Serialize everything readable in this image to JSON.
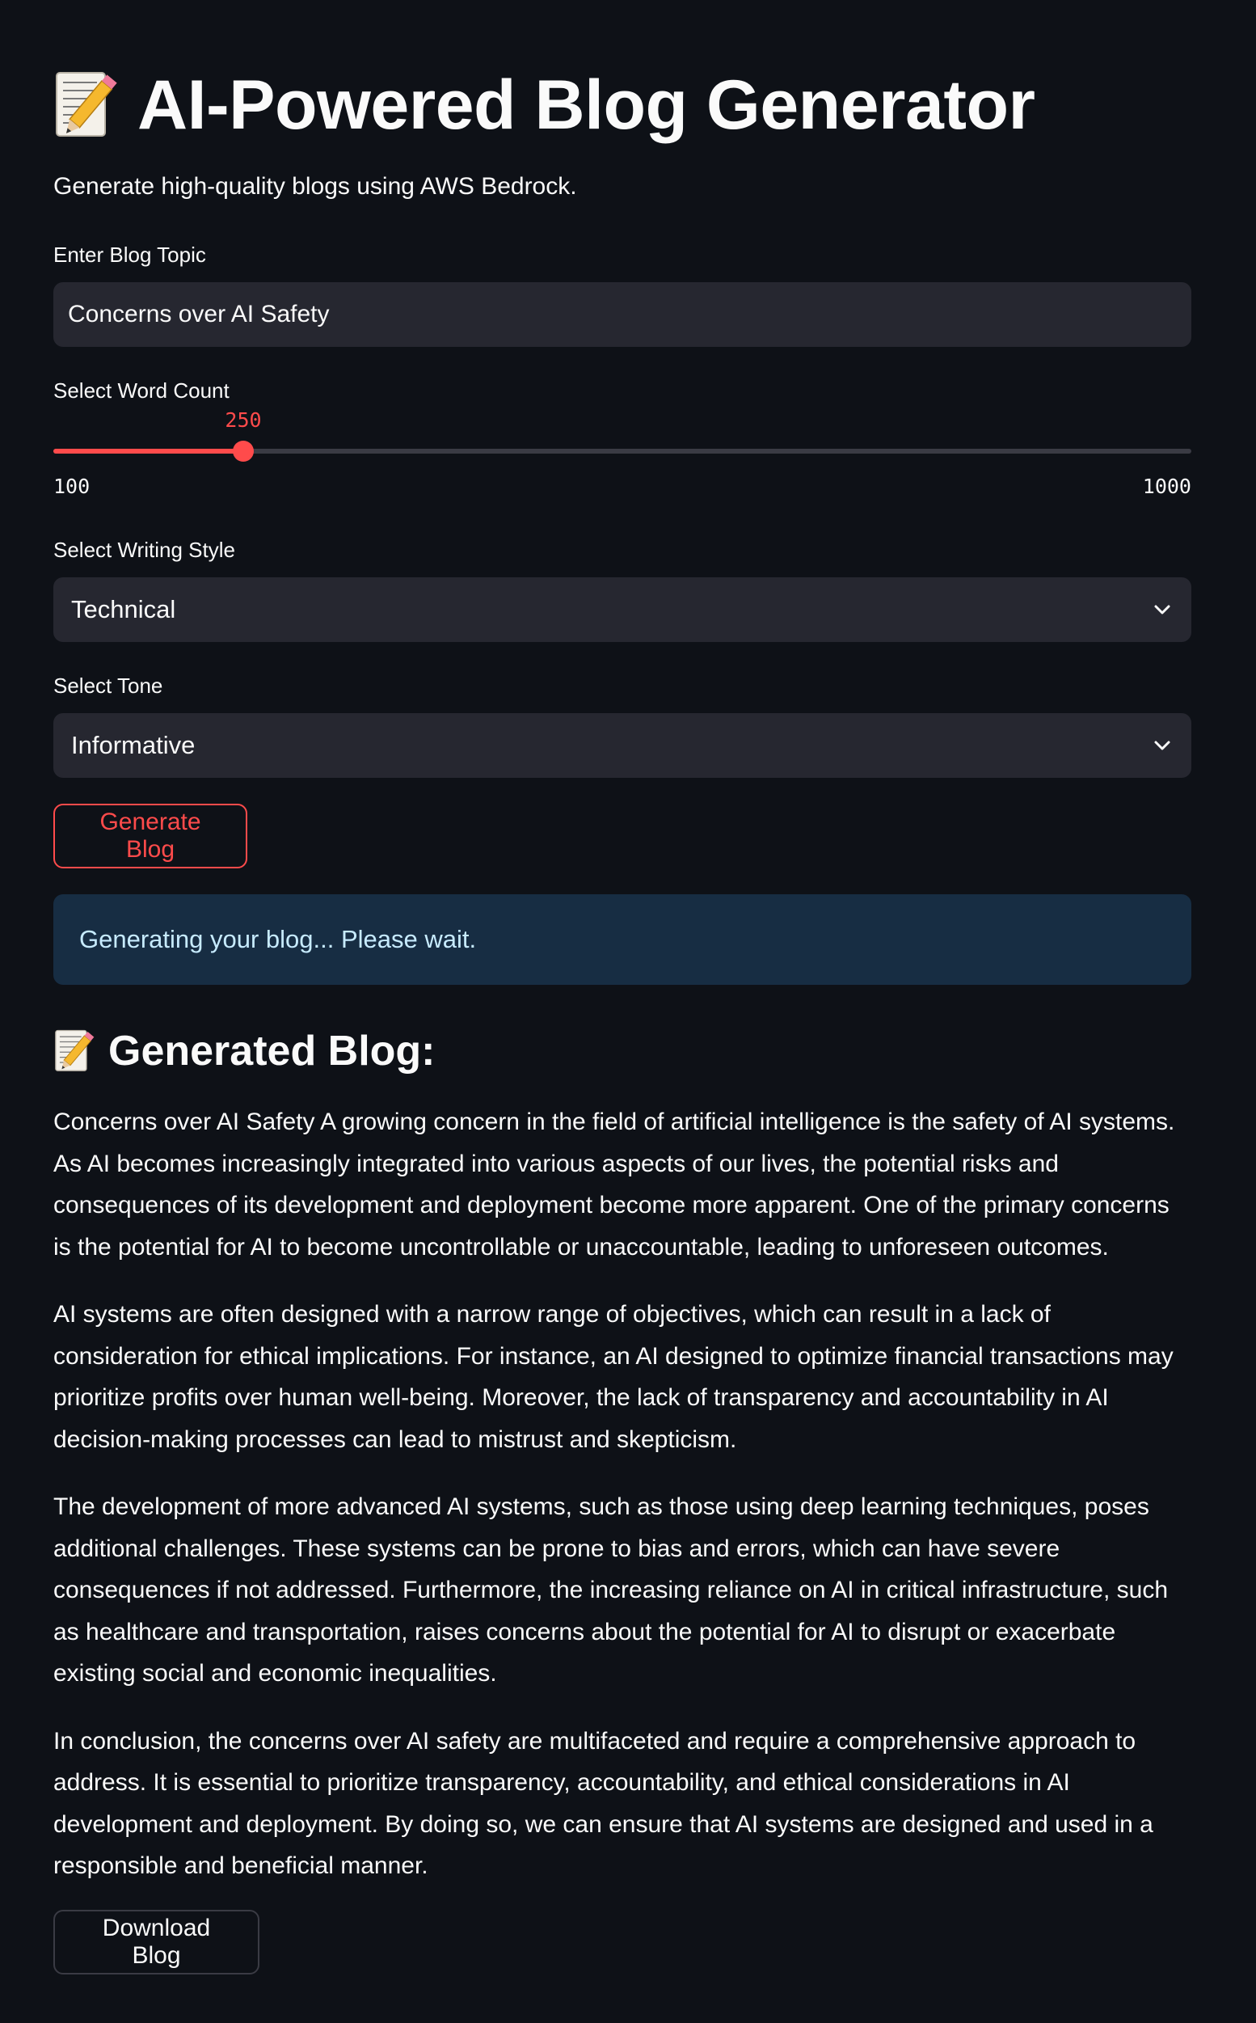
{
  "header": {
    "title": "AI-Powered Blog Generator",
    "subtitle": "Generate high-quality blogs using AWS Bedrock.",
    "title_icon": "memo-icon"
  },
  "form": {
    "topic": {
      "label": "Enter Blog Topic",
      "value": "Concerns over AI Safety"
    },
    "word_count": {
      "label": "Select Word Count",
      "value": 250,
      "value_text": "250",
      "min": 100,
      "min_text": "100",
      "max": 1000,
      "max_text": "1000"
    },
    "style": {
      "label": "Select Writing Style",
      "selected": "Technical"
    },
    "tone": {
      "label": "Select Tone",
      "selected": "Informative"
    },
    "generate_label": "Generate Blog"
  },
  "status": {
    "info_text": "Generating your blog... Please wait."
  },
  "result": {
    "heading": "Generated Blog:",
    "heading_icon": "memo-icon",
    "paragraphs": [
      "Concerns over AI Safety A growing concern in the field of artificial intelligence is the safety of AI systems. As AI becomes increasingly integrated into various aspects of our lives, the potential risks and consequences of its development and deployment become more apparent. One of the primary concerns is the potential for AI to become uncontrollable or unaccountable, leading to unforeseen outcomes.",
      "AI systems are often designed with a narrow range of objectives, which can result in a lack of consideration for ethical implications. For instance, an AI designed to optimize financial transactions may prioritize profits over human well-being. Moreover, the lack of transparency and accountability in AI decision-making processes can lead to mistrust and skepticism.",
      "The development of more advanced AI systems, such as those using deep learning techniques, poses additional challenges. These systems can be prone to bias and errors, which can have severe consequences if not addressed. Furthermore, the increasing reliance on AI in critical infrastructure, such as healthcare and transportation, raises concerns about the potential for AI to disrupt or exacerbate existing social and economic inequalities.",
      "In conclusion, the concerns over AI safety are multifaceted and require a comprehensive approach to address. It is essential to prioritize transparency, accountability, and ethical considerations in AI development and deployment. By doing so, we can ensure that AI systems are designed and used in a responsible and beneficial manner."
    ],
    "download_label": "Download Blog"
  },
  "colors": {
    "background": "#0e1117",
    "input_bg": "#262730",
    "accent": "#ff4b4b",
    "info_bg": "#172d43",
    "info_text": "#c7ebff"
  }
}
